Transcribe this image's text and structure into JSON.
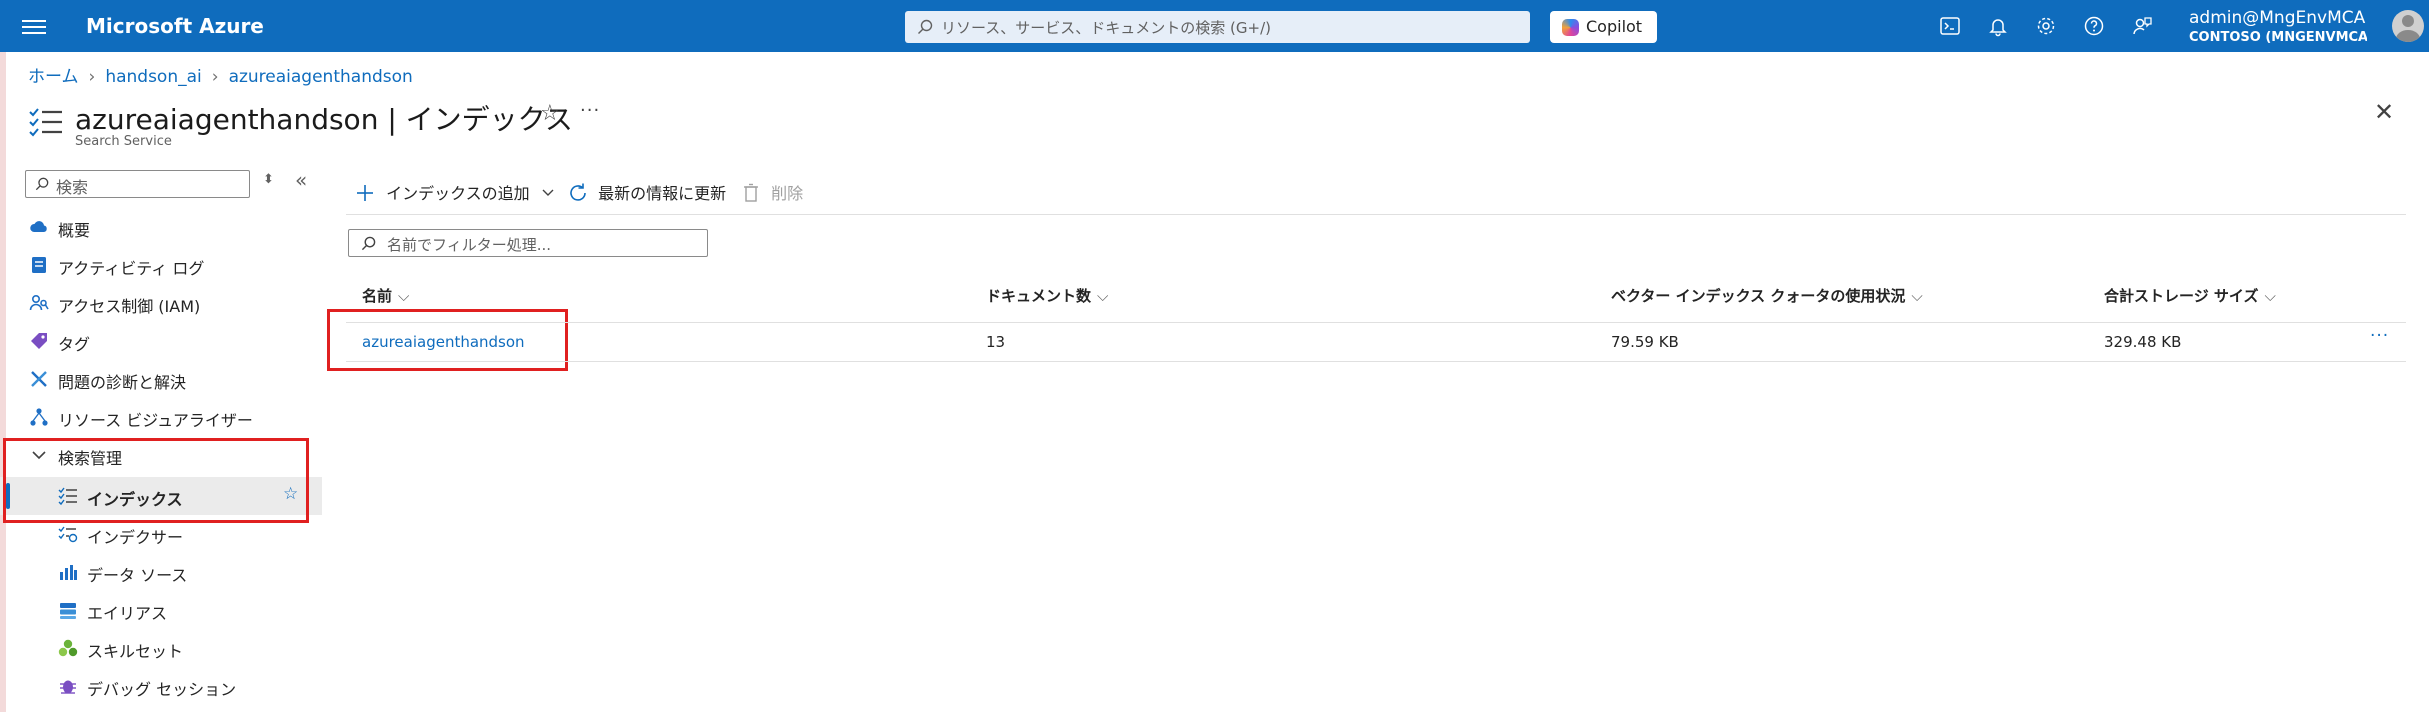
{
  "topbar": {
    "brand": "Microsoft Azure",
    "search_placeholder": "リソース、サービス、ドキュメントの検索 (G+/)",
    "copilot_label": "Copilot",
    "user_name": "admin@MngEnvMCA…",
    "user_tenant": "CONTOSO (MNGENVMCAP3…",
    "accent_color": "#0f6cbd"
  },
  "breadcrumb": [
    "ホーム",
    "handson_ai",
    "azureaiagenthandson"
  ],
  "header": {
    "title": "azureaiagenthandson | インデックス",
    "subtitle": "Search Service"
  },
  "sidebar": {
    "search_placeholder": "検索",
    "items": [
      {
        "label": "概要",
        "icon": "cloud-icon"
      },
      {
        "label": "アクティビティ ログ",
        "icon": "activity-log-icon"
      },
      {
        "label": "アクセス制御 (IAM)",
        "icon": "people-icon"
      },
      {
        "label": "タグ",
        "icon": "tag-icon"
      },
      {
        "label": "問題の診断と解決",
        "icon": "wrench-icon"
      },
      {
        "label": "リソース ビジュアライザー",
        "icon": "visualizer-icon"
      },
      {
        "label": "検索管理",
        "icon": "chevron-down-icon"
      },
      {
        "label": "インデックス",
        "icon": "index-list-icon",
        "selected": true
      },
      {
        "label": "インデクサー",
        "icon": "indexer-icon"
      },
      {
        "label": "データ ソース",
        "icon": "data-source-icon"
      },
      {
        "label": "エイリアス",
        "icon": "alias-icon"
      },
      {
        "label": "スキルセット",
        "icon": "skillset-icon"
      },
      {
        "label": "デバッグ セッション",
        "icon": "bug-icon"
      }
    ]
  },
  "toolbar": {
    "add_index": "インデックスの追加",
    "refresh": "最新の情報に更新",
    "delete": "削除"
  },
  "filter": {
    "placeholder": "名前でフィルター処理..."
  },
  "table": {
    "columns": [
      "名前",
      "ドキュメント数",
      "ベクター インデックス クォータの使用状況",
      "合計ストレージ サイズ"
    ],
    "rows": [
      {
        "name": "azureaiagenthandson",
        "documents": "13",
        "vector_usage": "79.59 KB",
        "storage": "329.48 KB"
      }
    ]
  }
}
